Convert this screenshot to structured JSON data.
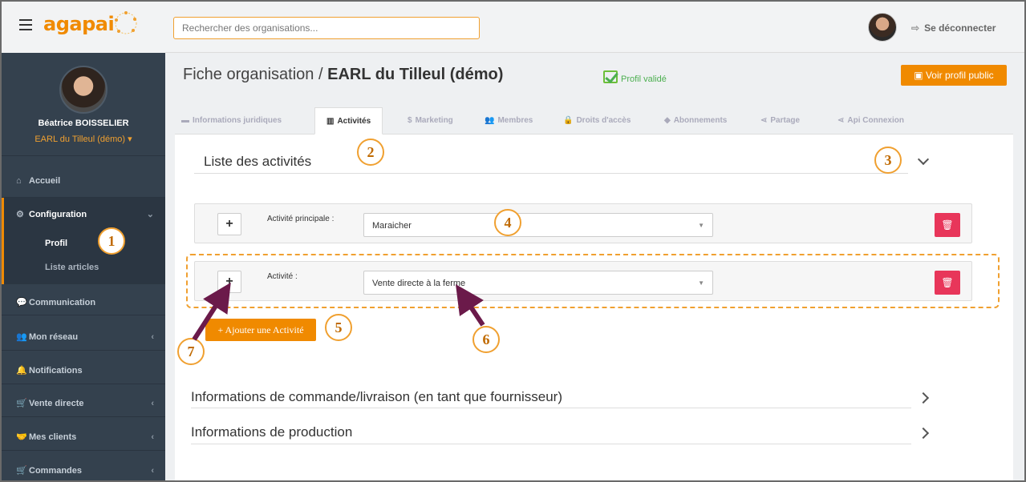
{
  "app": {
    "logo_text": "agapai",
    "logout_label": "Se déconnecter"
  },
  "search": {
    "placeholder": "Rechercher des organisations..."
  },
  "sidebar": {
    "user_name": "Béatrice BOISSELIER",
    "org_name": "EARL du Tilleul (démo)",
    "org_caret": "▾",
    "items": [
      {
        "label": "Accueil",
        "icon": "home-icon"
      },
      {
        "label": "Configuration",
        "icon": "cogs-icon"
      },
      {
        "label": "Communication",
        "icon": "comments-icon"
      },
      {
        "label": "Mon réseau",
        "icon": "users-icon"
      },
      {
        "label": "Notifications",
        "icon": "bell-icon"
      },
      {
        "label": "Vente directe",
        "icon": "cart-icon"
      },
      {
        "label": "Mes clients",
        "icon": "handshake-icon"
      },
      {
        "label": "Commandes",
        "icon": "cart-arrow-icon"
      }
    ],
    "config_sub": [
      "Profil",
      "Liste articles"
    ]
  },
  "page": {
    "title_prefix": "Fiche organisation / ",
    "title_org": "EARL du Tilleul (démo)",
    "validated_label": "Profil validé",
    "public_button": "Voir profil public"
  },
  "tabs": [
    {
      "label": "Informations juridiques",
      "icon": "folder-icon"
    },
    {
      "label": "Activités",
      "icon": "bar-chart-icon",
      "active": true
    },
    {
      "label": "Marketing",
      "icon": "dollar-icon"
    },
    {
      "label": "Membres",
      "icon": "users-icon"
    },
    {
      "label": "Droits d'accès",
      "icon": "lock-icon"
    },
    {
      "label": "Abonnements",
      "icon": "tag-icon"
    },
    {
      "label": "Partage",
      "icon": "share-icon"
    },
    {
      "label": "Api Connexion",
      "icon": "share-icon"
    }
  ],
  "sections": {
    "activities_title": "Liste des activités",
    "order_title": "Informations de commande/livraison (en tant que fournisseur)",
    "production_title": "Informations de production"
  },
  "activities": [
    {
      "label": "Activité principale :",
      "value": "Maraicher"
    },
    {
      "label": "Activité :",
      "value": "Vente directe à la ferme"
    }
  ],
  "buttons": {
    "plus": "+",
    "add_activity": "+ Ajouter une Activité"
  },
  "annotations": [
    "1",
    "2",
    "3",
    "4",
    "5",
    "6",
    "7"
  ],
  "colors": {
    "brand": "#f08a00",
    "sidebar": "#34414e",
    "danger": "#e8365a",
    "annotation": "#f0a030",
    "arrow": "#6b1a4a"
  }
}
